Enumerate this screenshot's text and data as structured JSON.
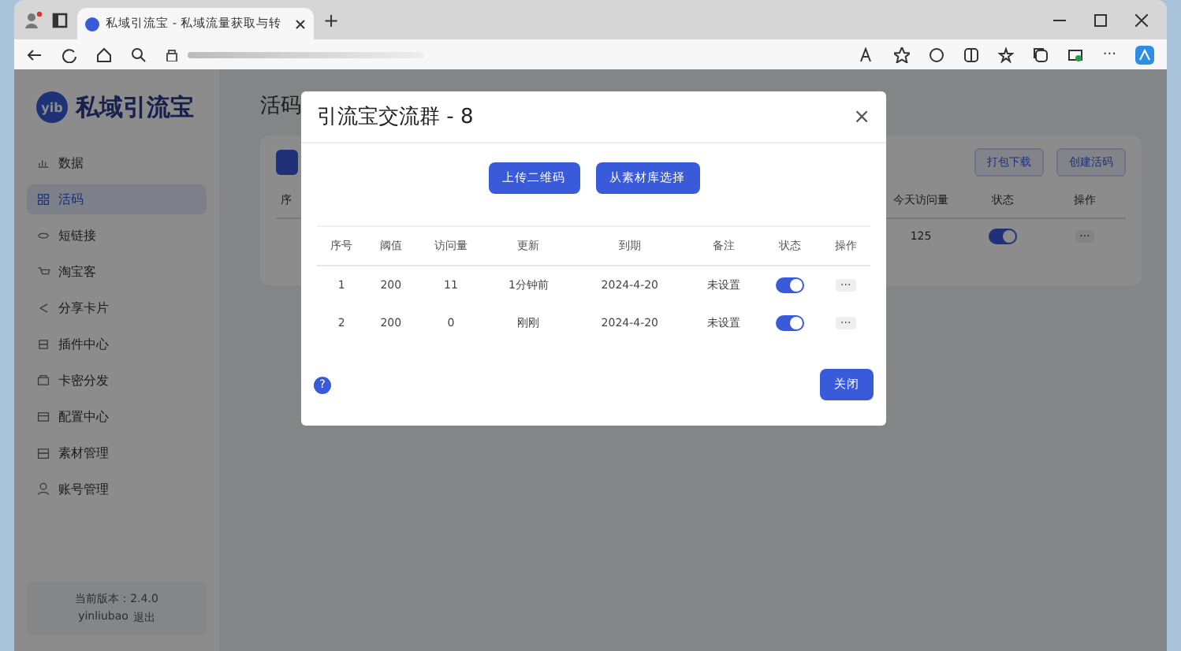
{
  "browser": {
    "tab_title": "私域引流宝 - 私域流量获取与转",
    "new_tab": "+",
    "menu": "···"
  },
  "sidebar": {
    "logo_badge": "yib",
    "logo_text": "私域引流宝",
    "items": [
      {
        "label": "数据",
        "selected": false
      },
      {
        "label": "活码",
        "selected": true
      },
      {
        "label": "短链接",
        "selected": false
      },
      {
        "label": "淘宝客",
        "selected": false
      },
      {
        "label": "分享卡片",
        "selected": false
      },
      {
        "label": "插件中心",
        "selected": false
      },
      {
        "label": "卡密分发",
        "selected": false
      },
      {
        "label": "配置中心",
        "selected": false
      },
      {
        "label": "素材管理",
        "selected": false
      },
      {
        "label": "账号管理",
        "selected": false
      }
    ],
    "version": "当前版本：2.4.0",
    "user": "yinliubao",
    "logout": "退出"
  },
  "page": {
    "title": "活码",
    "buttons": [
      "打包下载",
      "创建活码"
    ],
    "columns": [
      "序",
      "今天访问量",
      "状态",
      "操作"
    ],
    "row": {
      "today": "125",
      "on": true,
      "action": "···"
    }
  },
  "modal": {
    "title": "引流宝交流群 - 8",
    "close": "×",
    "buttons": [
      "上传二维码",
      "从素材库选择"
    ],
    "columns": [
      "序号",
      "阈值",
      "访问量",
      "更新",
      "到期",
      "备注",
      "状态",
      "操作"
    ],
    "rows": [
      {
        "index": "1",
        "threshold": "200",
        "visits": "11",
        "updated": "1分钟前",
        "expires": "2024-4-20",
        "note": "未设置",
        "on": true,
        "action": "···"
      },
      {
        "index": "2",
        "threshold": "200",
        "visits": "0",
        "updated": "刚刚",
        "expires": "2024-4-20",
        "note": "未设置",
        "on": true,
        "action": "···"
      }
    ],
    "help": "?",
    "close_button": "关闭"
  }
}
